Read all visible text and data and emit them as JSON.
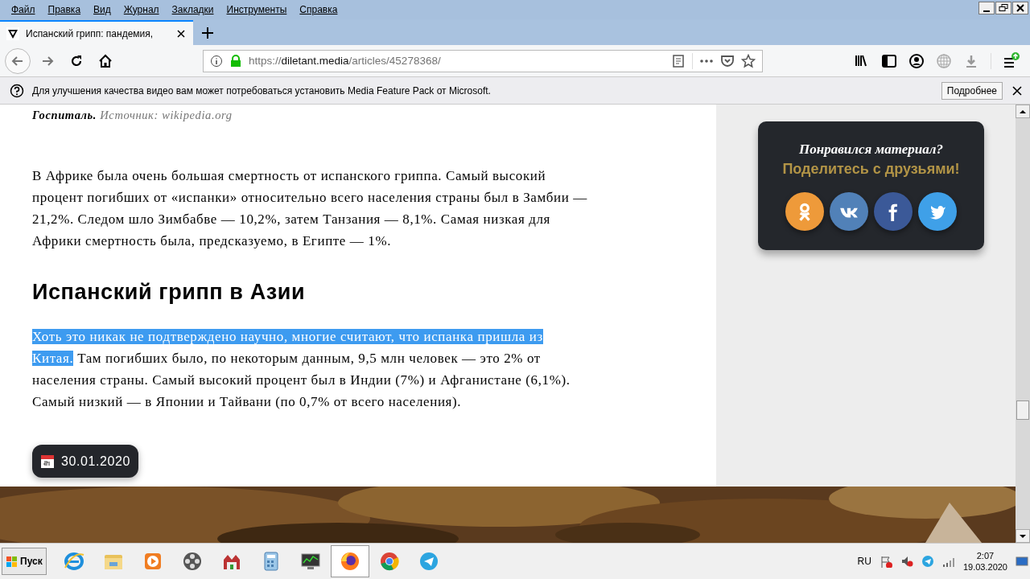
{
  "menu": [
    "Файл",
    "Правка",
    "Вид",
    "Журнал",
    "Закладки",
    "Инструменты",
    "Справка"
  ],
  "tabs": [
    {
      "title": "Испанский грипп: пандемия,",
      "selected": true
    }
  ],
  "address": {
    "scheme": "https://",
    "host": "diletant.media",
    "path": "/articles/45278368/"
  },
  "notification": {
    "text": "Для улучшения качества видео вам может потребоваться установить Media Feature Pack от Microsoft.",
    "button": "Подробнее"
  },
  "article": {
    "caption_title": "Госпиталь.",
    "caption_source": "Источник: wikipedia.org",
    "paragraph_1": "В Африке была очень большая смертность от испанского гриппа. Самый высокий процент погибших от «испанки» относительно всего населения страны был в Замбии — 21,2%. Следом шло Зимбабве — 10,2%, затем Танзания — 8,1%. Самая низкая для Африки смертность была, предсказуемо, в Египте — 1%.",
    "heading": "Испанский грипп в Азии",
    "paragraph_2_selected": "Хоть это никак не подтверждено научно, многие считают, что испанка пришла из Китая.",
    "paragraph_2": " Там погибших было, по некоторым данным, 9,5 млн человек — это 2% от населения страны. Самый высокий процент был в Индии (7%) и Афганистане (6,1%). Самый низкий — в Японии и Тайвани (по 0,7% от всего населения).",
    "date": "30.01.2020"
  },
  "share": {
    "title": "Понравился материал?",
    "subtitle": "Поделитесь с друзьями!",
    "buttons": [
      {
        "kind": "ok",
        "color": "#ee9a3a"
      },
      {
        "kind": "vk",
        "color": "#5181b8"
      },
      {
        "kind": "fb",
        "color": "#3b5998"
      },
      {
        "kind": "tw",
        "color": "#3fa0e8"
      }
    ]
  },
  "taskbar": {
    "start": "Пуск",
    "apps": [
      {
        "kind": "ie",
        "selected": false
      },
      {
        "kind": "folder",
        "selected": false
      },
      {
        "kind": "media",
        "selected": false
      },
      {
        "kind": "reel",
        "selected": false
      },
      {
        "kind": "archive",
        "selected": false
      },
      {
        "kind": "calc",
        "selected": false
      },
      {
        "kind": "monitor",
        "selected": false
      },
      {
        "kind": "firefox",
        "selected": true
      },
      {
        "kind": "chrome",
        "selected": false
      },
      {
        "kind": "telegram",
        "selected": false
      }
    ],
    "language": "RU",
    "time": "2:07",
    "date": "19.03.2020"
  }
}
